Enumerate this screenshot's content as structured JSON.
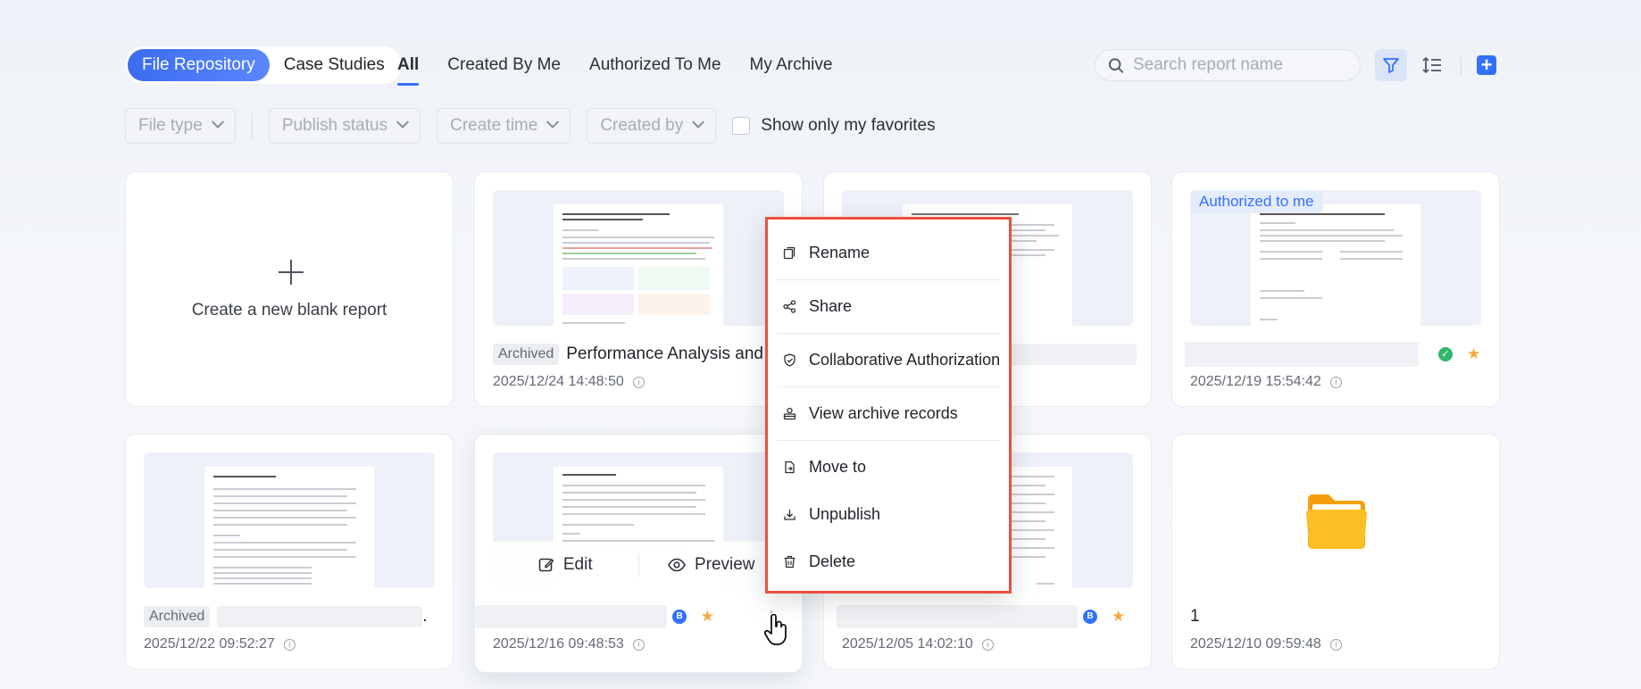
{
  "header": {
    "segments": [
      "File Repository",
      "Case Studies"
    ],
    "tabs": [
      "All",
      "Created By Me",
      "Authorized To Me",
      "My Archive"
    ],
    "search_placeholder": "Search report name"
  },
  "filters": {
    "file_type": "File type",
    "publish_status": "Publish status",
    "create_time": "Create time",
    "created_by": "Created by",
    "favorites_label": "Show only my favorites"
  },
  "cards": {
    "new_label": "Create a new blank report",
    "c2": {
      "badge": "Archived",
      "title": "Performance Analysis and ...",
      "date": "2025/12/24 14:48:50"
    },
    "c4": {
      "auth": "Authorized to me",
      "date": "2025/12/19 15:54:42"
    },
    "c5": {
      "badge": "Archived",
      "title_tail": ".",
      "date": "2025/12/22 09:52:27"
    },
    "c6": {
      "date": "2025/12/16 09:48:53",
      "edit": "Edit",
      "preview": "Preview"
    },
    "c7": {
      "date": "2025/12/05 14:02:10"
    },
    "c8": {
      "title": "1",
      "date": "2025/12/10 09:59:48"
    }
  },
  "context_menu": {
    "items": [
      "Rename",
      "Share",
      "Collaborative Authorization",
      "View archive records",
      "Move to",
      "Unpublish",
      "Delete"
    ]
  },
  "colors": {
    "accent": "#3370ff",
    "highlight": "#e9503f",
    "star": "#f7a83b",
    "folder": "#fbbf24"
  }
}
